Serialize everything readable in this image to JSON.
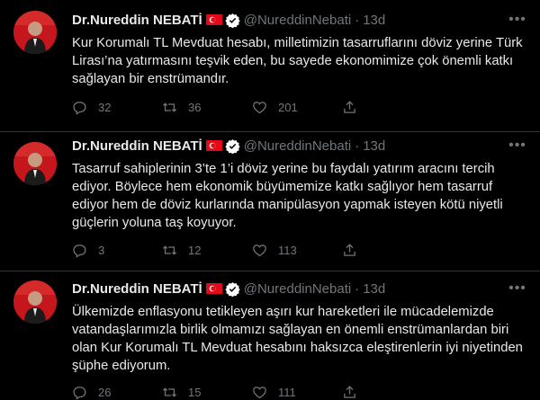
{
  "tweets": [
    {
      "name": "Dr.Nureddin NEBATİ",
      "handle": "@NureddinNebati",
      "separator": "·",
      "time": "13d",
      "text": "Kur Korumalı TL Mevduat hesabı, milletimizin tasarruflarını döviz yerine Türk Lirası’na yatırmasını teşvik eden, bu sayede ekonomimize çok önemli katkı sağlayan bir enstrümandır.",
      "replies": "32",
      "retweets": "36",
      "likes": "201"
    },
    {
      "name": "Dr.Nureddin NEBATİ",
      "handle": "@NureddinNebati",
      "separator": "·",
      "time": "13d",
      "text": "Tasarruf sahiplerinin 3’te 1’i döviz yerine bu faydalı yatırım aracını tercih ediyor. Böylece hem ekonomik büyümemize katkı sağlıyor hem tasarruf ediyor hem de döviz kurlarında manipülasyon yapmak isteyen kötü niyetli güçlerin yoluna taş koyuyor.",
      "replies": "3",
      "retweets": "12",
      "likes": "113"
    },
    {
      "name": "Dr.Nureddin NEBATİ",
      "handle": "@NureddinNebati",
      "separator": "·",
      "time": "13d",
      "text": "Ülkemizde enflasyonu tetikleyen aşırı kur hareketleri ile mücadelemizde vatandaşlarımızla birlik olmamızı sağlayan en önemli enstrümanlardan biri olan Kur Korumalı TL Mevduat hesabını haksızca eleştirenlerin iyi niyetinden şüphe ediyorum.",
      "replies": "26",
      "retweets": "15",
      "likes": "111"
    }
  ],
  "icons": {
    "reply": "reply-icon",
    "retweet": "retweet-icon",
    "like": "heart-icon",
    "share": "share-icon",
    "more": "more-icon",
    "verified": "verified-badge-icon",
    "flag": "turkey-flag-icon"
  },
  "colors": {
    "background": "#000000",
    "text": "#e7e9ea",
    "muted": "#71767b",
    "divider": "#2f3336",
    "flag_red": "#e30a17"
  }
}
